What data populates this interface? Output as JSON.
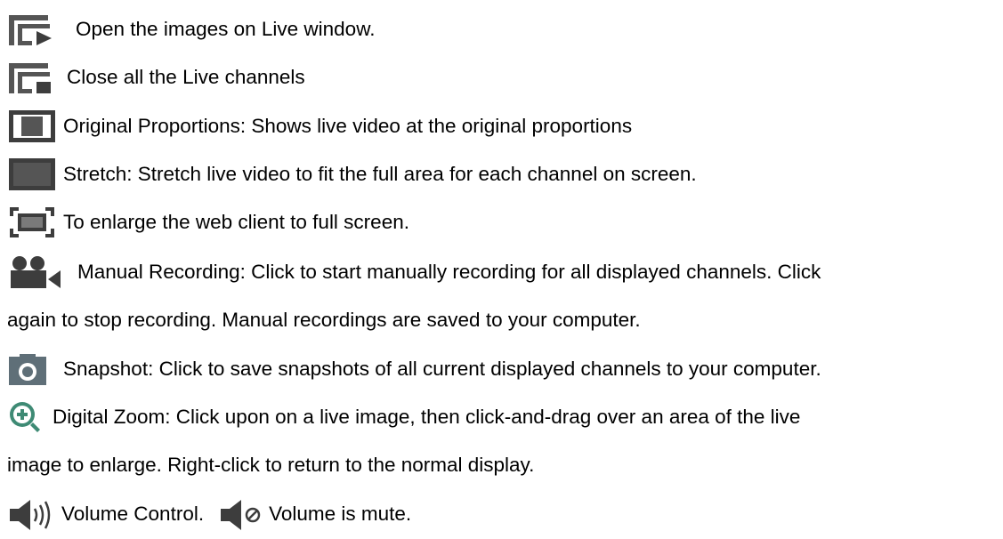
{
  "colors": {
    "icon_dark": "#3d3d3d",
    "icon_mid": "#555555",
    "icon_light": "#7a7a7a",
    "snapshot_bg": "#5f6f78",
    "zoom_fill": "#3e8a74",
    "text": "#000000"
  },
  "icons": {
    "open_live": "open-live-window-icon",
    "close_live": "close-live-channels-icon",
    "original": "original-proportions-icon",
    "stretch": "stretch-icon",
    "fullscreen": "fullscreen-icon",
    "recording": "video-camera-icon",
    "snapshot": "camera-icon",
    "zoom": "zoom-in-icon",
    "volume": "volume-icon",
    "mute": "volume-mute-icon"
  },
  "lines": {
    "open_live": "Open the images on Live window.",
    "close_live": "Close all the Live channels",
    "original": "Original Proportions: Shows live video at the original proportions",
    "stretch": "Stretch: Stretch live video to fit the full area for each channel on screen.",
    "fullscreen": "To enlarge the web client to full screen.",
    "recording_1": "Manual Recording: Click to start manually recording for all displayed channels. Click",
    "recording_2": "again to stop recording. Manual recordings are saved to your computer.",
    "snapshot": "Snapshot: Click to save snapshots of all current displayed channels to your computer.",
    "zoom_1": "Digital Zoom: Click upon on a live image, then click-and-drag over an area of the live",
    "zoom_2": "image to enlarge. Right-click to return to the normal display.",
    "volume": "Volume Control.",
    "mute": "Volume is mute."
  }
}
